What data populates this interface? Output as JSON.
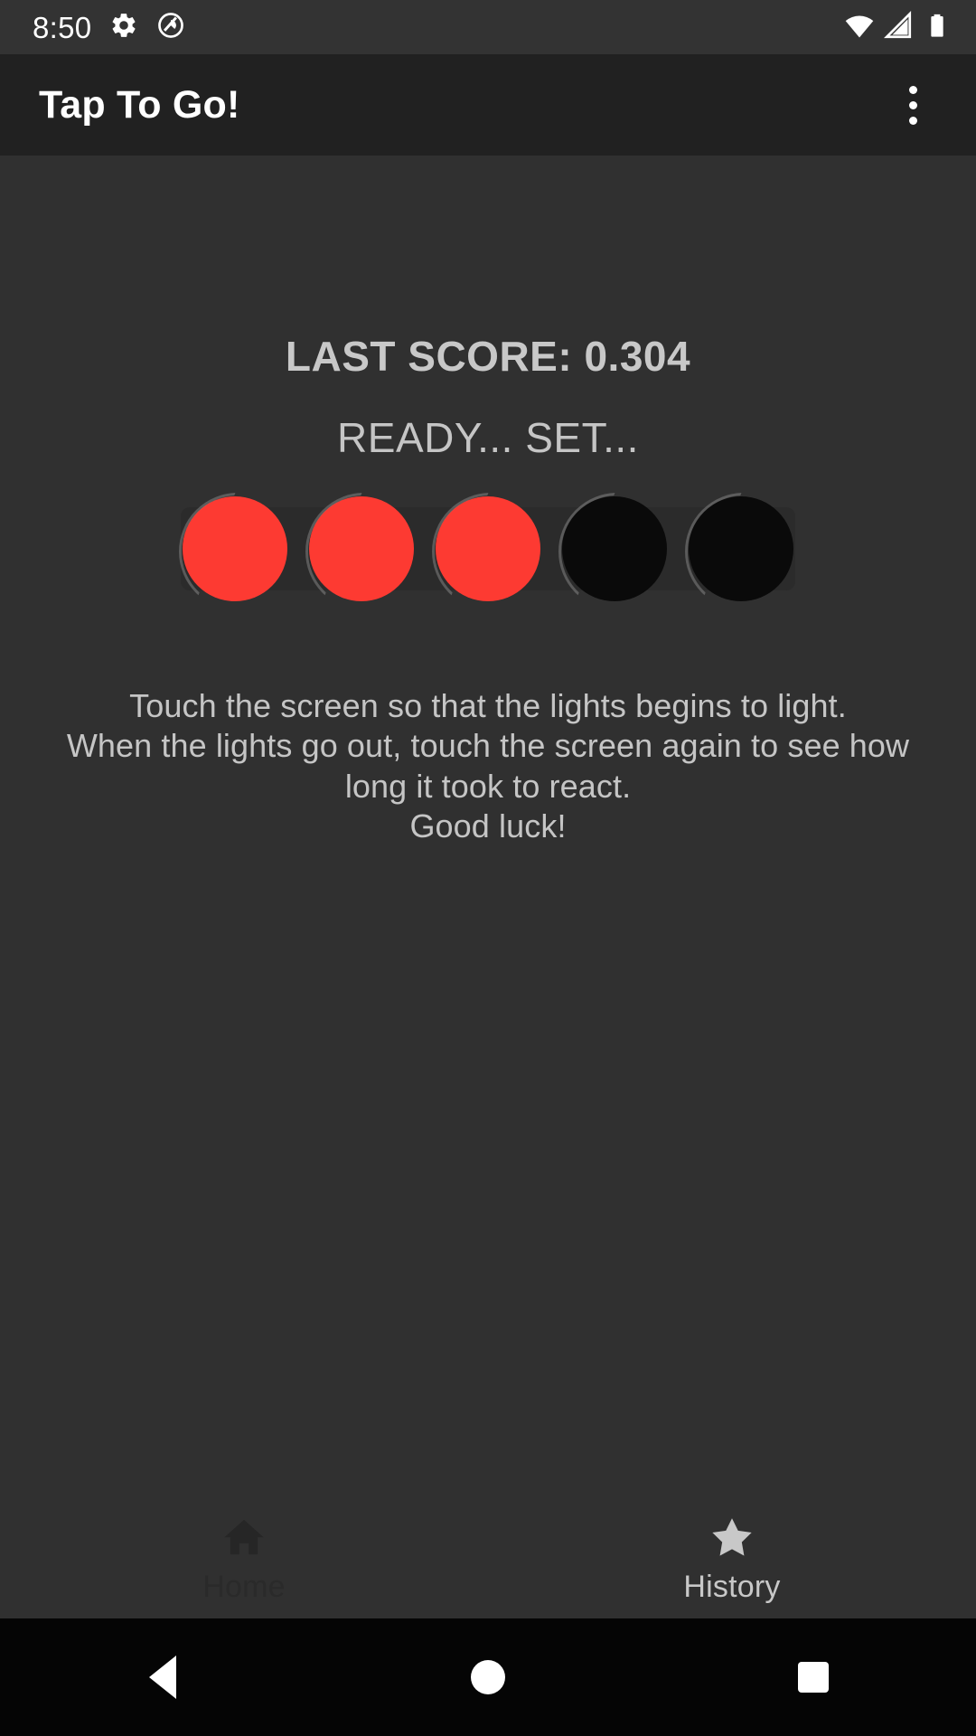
{
  "status_bar": {
    "time": "8:50",
    "left_icons": [
      "gear-icon",
      "do-not-disturb-icon"
    ],
    "right_icons": [
      "wifi-icon",
      "cellular-signal-icon",
      "battery-icon"
    ],
    "background_color": "#333333",
    "foreground_color": "#ffffff"
  },
  "app_bar": {
    "title": "Tap To Go!",
    "overflow_menu_label": "More options",
    "background_color": "#212121",
    "title_color": "#ffffff"
  },
  "main": {
    "last_score_text": "LAST SCORE: 0.304",
    "last_score_value": "0.304",
    "status_text": "READY... SET...",
    "background_color": "#303030",
    "text_color": "#c5c5c5",
    "lights": {
      "count": 5,
      "states": [
        "on",
        "on",
        "on",
        "off",
        "off"
      ],
      "on_color": "#fd3a32",
      "off_color": "#0a0a0a",
      "plate_color": "#2b2b2b"
    },
    "instructions": [
      "Touch the screen so that the lights begins to light.",
      "When the lights go out, touch the screen again to see how",
      "long it took to react.",
      "Good luck!"
    ]
  },
  "bottom_nav": {
    "items": [
      {
        "label": "Home",
        "icon": "home-icon",
        "state": "dim",
        "color": "#2a2a2a"
      },
      {
        "label": "History",
        "icon": "star-icon",
        "state": "bright",
        "color": "#c8c8c8"
      }
    ]
  },
  "android_nav": {
    "back_label": "Back",
    "home_label": "Home",
    "recents_label": "Recents",
    "background_color": "#050505",
    "icon_color": "#ffffff"
  }
}
